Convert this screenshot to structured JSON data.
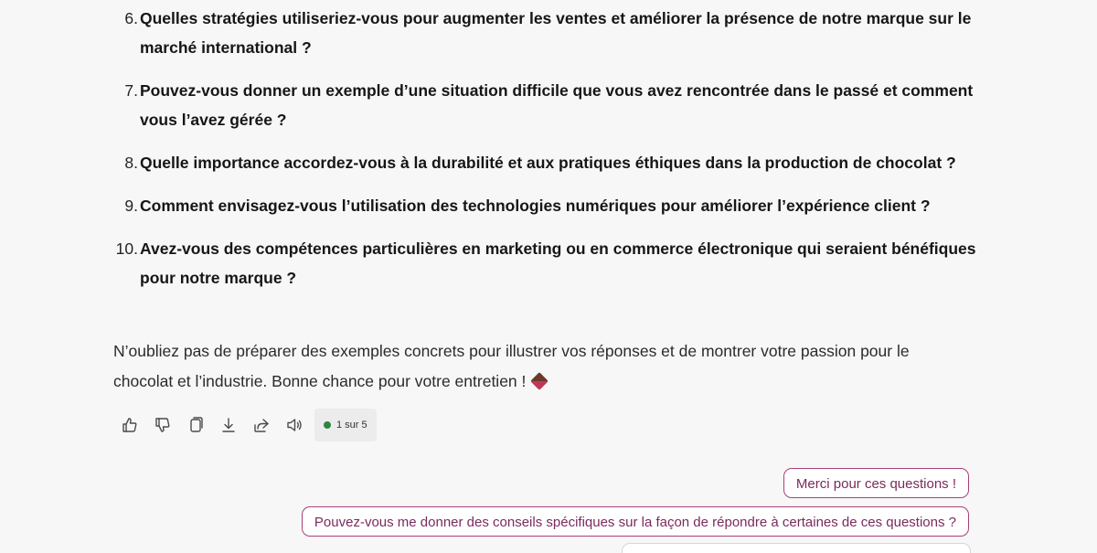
{
  "questions": [
    {
      "number": "6.",
      "text": "Quelles stratégies utiliseriez-vous pour augmenter les ventes et améliorer la présence de notre marque sur le marché international ?"
    },
    {
      "number": "7.",
      "text": "Pouvez-vous donner un exemple d’une situation difficile que vous avez rencontrée dans le passé et comment vous l’avez gérée ?"
    },
    {
      "number": "8.",
      "text": "Quelle importance accordez-vous à la durabilité et aux pratiques éthiques dans la production de chocolat ?"
    },
    {
      "number": "9.",
      "text": "Comment envisagez-vous l’utilisation des technologies numériques pour améliorer l’expérience client ?"
    },
    {
      "number": "10.",
      "text": "Avez-vous des compétences particulières en marketing ou en commerce électronique qui seraient bénéfiques pour notre marque ?"
    }
  ],
  "closing_text": "N’oubliez pas de préparer des exemples concrets pour illustrer vos réponses et de montrer votre passion pour le chocolat et l’industrie. Bonne chance pour votre entretien !",
  "closing_emoji": "chocolate-emoji",
  "toolbar": {
    "icons": [
      "thumbs-up-icon",
      "thumbs-down-icon",
      "copy-icon",
      "download-icon",
      "share-icon",
      "speaker-icon"
    ],
    "page_indicator": "1 sur 5",
    "status_color": "#2e8540"
  },
  "suggestions": [
    "Merci pour ces questions !",
    "Pouvez-vous me donner des conseils spécifiques sur la façon de répondre à certaines de ces questions ?"
  ],
  "colors": {
    "suggestion_border": "#a8407a",
    "suggestion_text": "#7b2a5e"
  }
}
